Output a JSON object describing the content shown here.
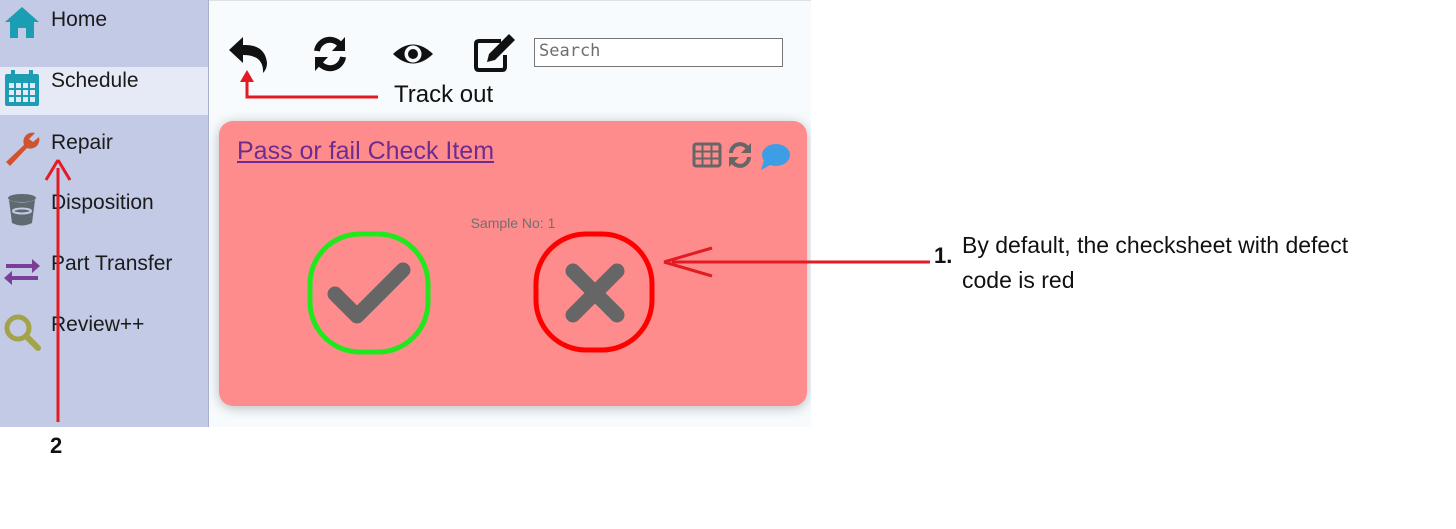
{
  "sidebar": {
    "items": [
      {
        "label": "Home",
        "icon": "home-icon"
      },
      {
        "label": "Schedule",
        "icon": "calendar-icon",
        "active": true
      },
      {
        "label": "Repair",
        "icon": "wrench-icon"
      },
      {
        "label": "Disposition",
        "icon": "bin-icon"
      },
      {
        "label": "Part Transfer",
        "icon": "transfer-arrows-icon"
      },
      {
        "label": "Review++",
        "icon": "magnifier-icon"
      }
    ]
  },
  "toolbar": {
    "icons": [
      "undo-arrow-icon",
      "refresh-icon",
      "eye-icon",
      "edit-icon"
    ],
    "search_placeholder": "Search"
  },
  "card": {
    "title": "Pass or fail Check Item",
    "sample_label": "Sample No: 1",
    "background": "#ff8c8c",
    "pass_ring_color": "#1fe81f",
    "fail_ring_color": "#ff0000"
  },
  "annotations": {
    "track_out": "Track out",
    "note_number": "1.",
    "note_text_line1": "By default, the checksheet with defect",
    "note_text_line2": "code is red",
    "arrow_number": "2",
    "arrow_color": "#e31b23"
  }
}
